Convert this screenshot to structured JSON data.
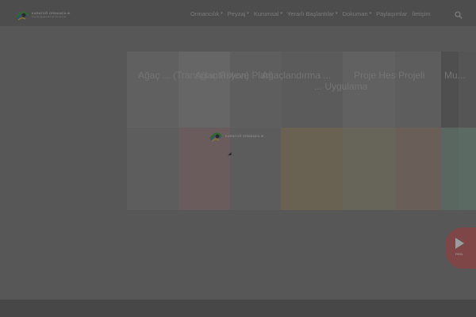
{
  "brand": {
    "name": "KARATOĞ ORMANCILIK",
    "tagline": "Peyzaj Ağaçlandırma Ormancılık",
    "colors": {
      "green": "#3b8f3b",
      "blue": "#2d5fa3",
      "yellow": "#c9b23a"
    }
  },
  "nav": {
    "items": [
      {
        "label": "Ormancılık",
        "has_menu": true
      },
      {
        "label": "Peyzaj",
        "has_menu": true
      },
      {
        "label": "Kurumsal",
        "has_menu": true
      },
      {
        "label": "Yerarlı Başlantılar",
        "has_menu": true
      },
      {
        "label": "Dokuman",
        "has_menu": true
      },
      {
        "label": "Paylaşımlar",
        "has_menu": false
      },
      {
        "label": "İletişim",
        "has_menu": false
      }
    ],
    "search_icon": "search-icon"
  },
  "gallery": {
    "panels": [
      {
        "title": "Ağaç ... (Transplantasyon)",
        "top_color": "#606060",
        "bottom_color": "#5d5d5d"
      },
      {
        "title": "Ağaç Röleve Planı",
        "top_color": "#626262",
        "bottom_color": "#6c5d5d"
      },
      {
        "title": "Ağaçlandırma ...",
        "top_color": "#5e5e5e",
        "bottom_color": "#5f5f5f"
      },
      {
        "title": "... Uygulama",
        "top_color": "#5c5c5c",
        "bottom_color": "#6a6356"
      },
      {
        "title": "Peyzaj ... ",
        "top_color": "#5f5f5f",
        "bottom_color": "#65655a"
      },
      {
        "title": "Proje Hes Projeli",
        "top_color": "#616161",
        "bottom_color": "#6a5e58"
      },
      {
        "title": "...",
        "top_color": "#5a5a5a",
        "bottom_color": "#5f6a63"
      },
      {
        "title": "Mu...",
        "top_color": "#5d5d5d",
        "bottom_color": "#5c6964"
      }
    ]
  },
  "play": {
    "label": "REEL",
    "icon": "play-icon"
  },
  "accent": "#7e4646"
}
